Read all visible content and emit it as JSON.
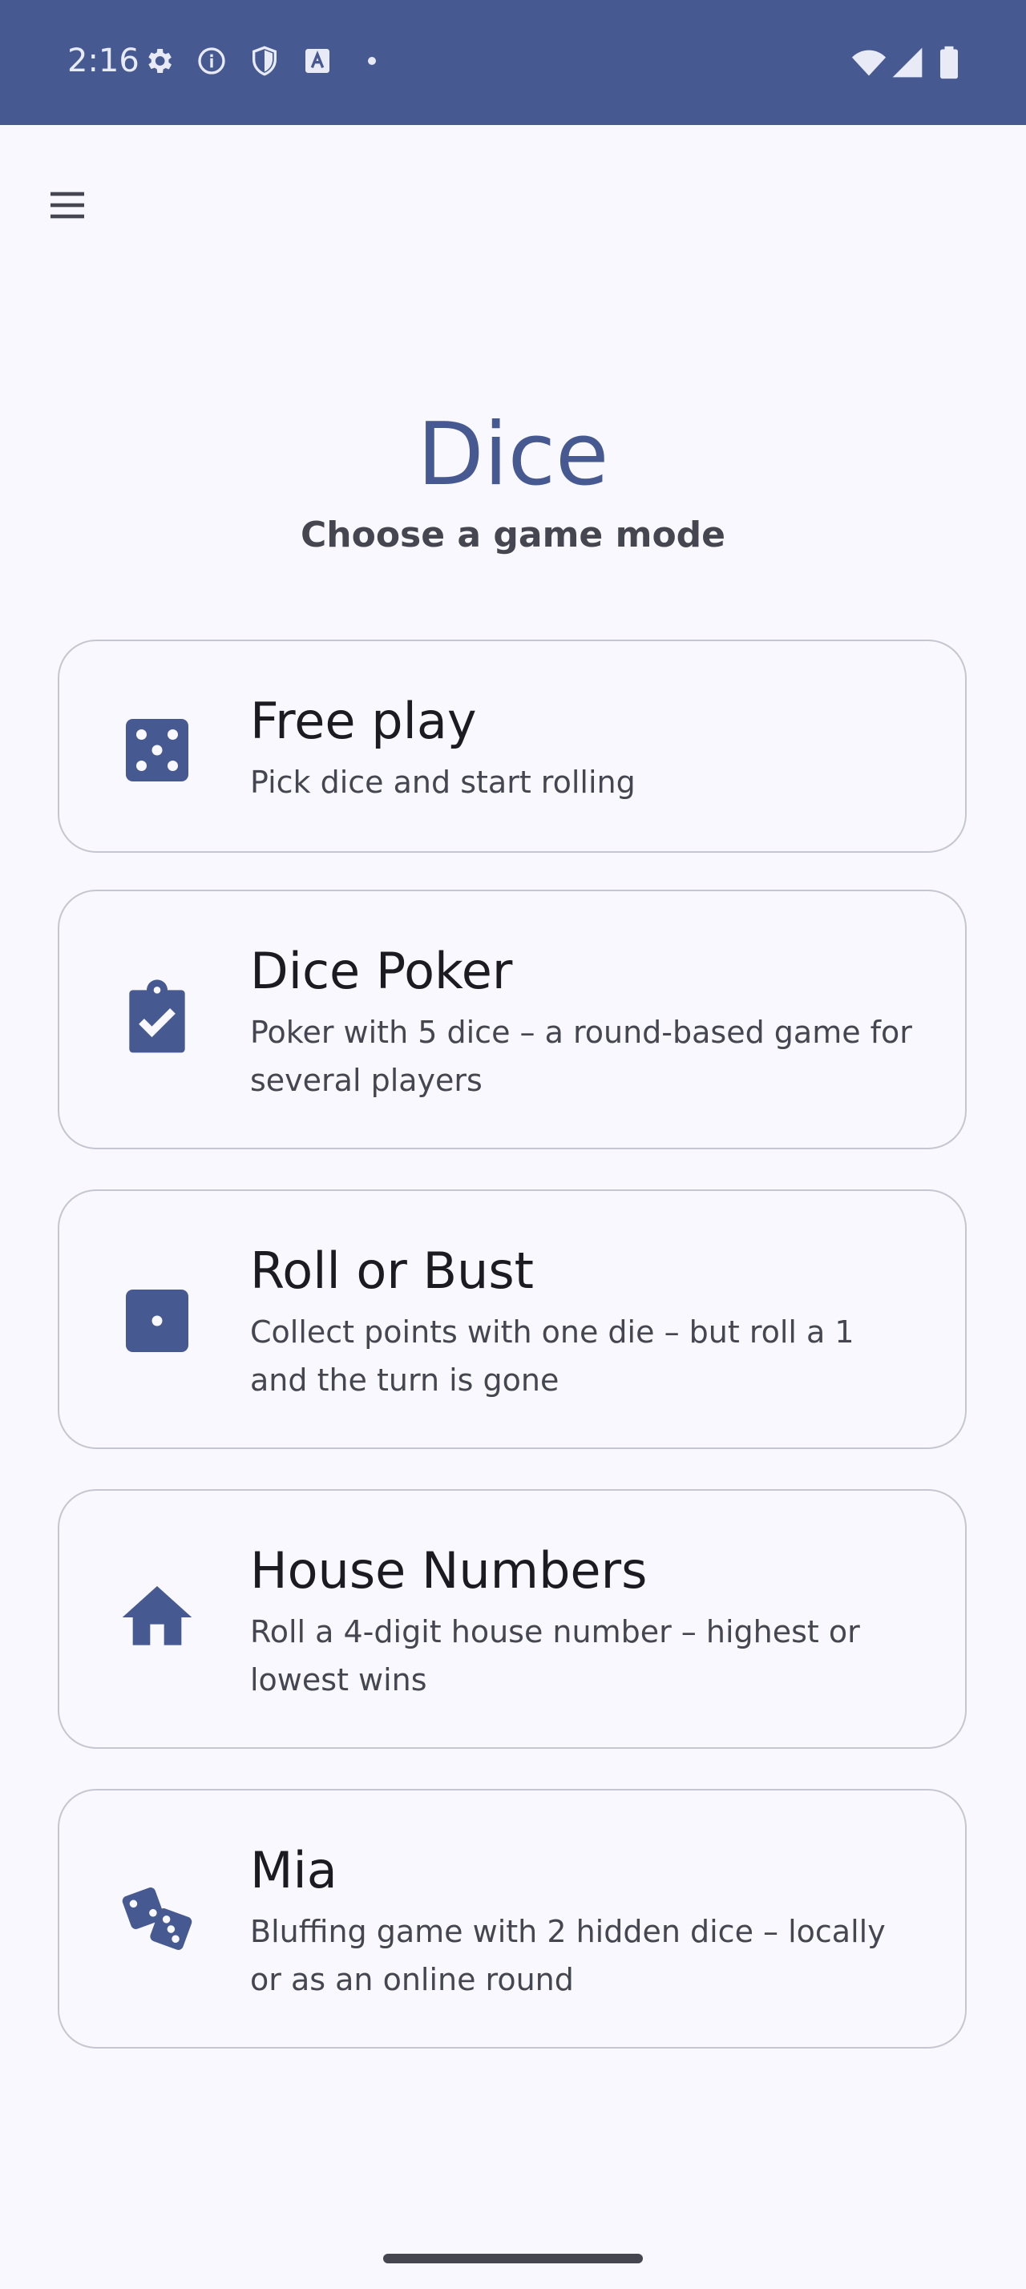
{
  "status_bar": {
    "time": "2:16",
    "icons": [
      "settings-icon",
      "info-icon",
      "shield-icon",
      "font-icon",
      "dot-icon",
      "wifi-icon",
      "signal-icon",
      "battery-icon"
    ]
  },
  "header": {
    "menu_icon": "menu-icon"
  },
  "main": {
    "title": "Dice",
    "subtitle": "Choose a game mode"
  },
  "modes": [
    {
      "title": "Free play",
      "description": "Pick dice and start rolling",
      "icon": "dice-five-icon"
    },
    {
      "title": "Dice Poker",
      "description": "Poker with 5 dice – a round-based game for several players",
      "icon": "clipboard-check-icon"
    },
    {
      "title": "Roll or Bust",
      "description": "Collect points with one die – but roll a 1 and the turn is gone",
      "icon": "dice-one-icon"
    },
    {
      "title": "House Numbers",
      "description": "Roll a 4-digit house number – highest or lowest wins",
      "icon": "house-icon"
    },
    {
      "title": "Mia",
      "description": "Bluffing game with 2 hidden dice – locally or as an online round",
      "icon": "two-dice-icon"
    }
  ],
  "colors": {
    "primary": "#465a91",
    "background": "#f8f8fe",
    "outline": "#c5c6d0",
    "on_surface": "#1b1b21",
    "on_surface_variant": "#45464f"
  }
}
